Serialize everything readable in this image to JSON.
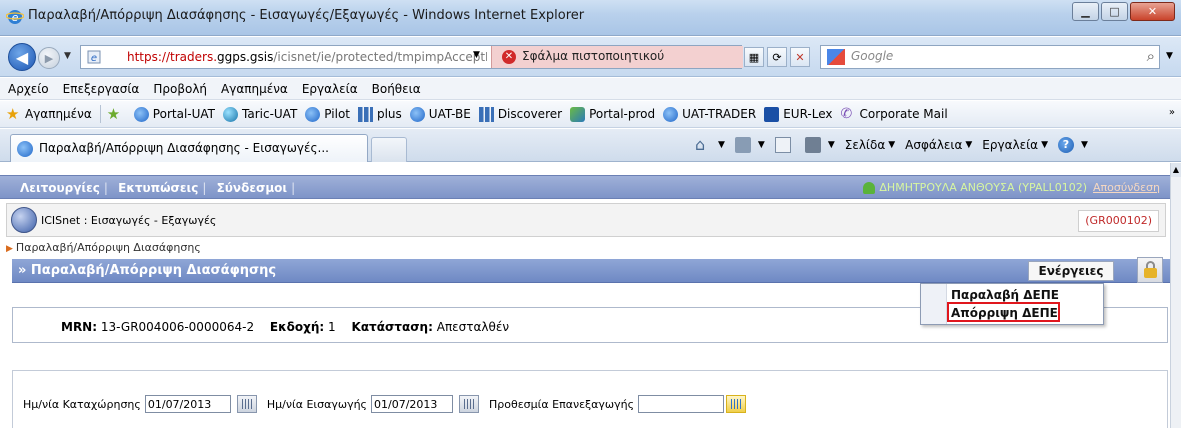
{
  "window": {
    "title": "Παραλαβή/Απόρριψη Διασάφησης - Εισαγωγές/Εξαγωγές - Windows Internet Explorer",
    "min_icon": "minimize-icon",
    "max_icon": "maximize-icon",
    "close_icon": "close-icon"
  },
  "address": {
    "url_prefix": "https://traders.",
    "url_domain": "ggps.gsis",
    "url_rest": "/icisnet/ie/protected/tmpimpAcceptR",
    "cert_error": "Σφάλμα πιστοποιητικού",
    "search_placeholder": "Google"
  },
  "menu": [
    "Αρχείο",
    "Επεξεργασία",
    "Προβολή",
    "Αγαπημένα",
    "Εργαλεία",
    "Βοήθεια"
  ],
  "favorites": {
    "label": "Αγαπημένα",
    "items": [
      "Portal-UAT",
      "Taric-UAT",
      "Pilot",
      "plus",
      "UAT-BE",
      "Discoverer",
      "Portal-prod",
      "UAT-TRADER",
      "EUR-Lex",
      "Corporate Mail"
    ]
  },
  "tab": {
    "title": "Παραλαβή/Απόρριψη Διασάφησης - Εισαγωγές..."
  },
  "commands": {
    "page": "Σελίδα",
    "safety": "Ασφάλεια",
    "tools": "Εργαλεία"
  },
  "app": {
    "nav": [
      "Λειτουργίες",
      "Εκτυπώσεις",
      "Σύνδεσμοι"
    ],
    "user": "ΔΗΜΗΤΡΟΥΛΑ ΑΝΘΟΥΣΑ (YPALL0102)",
    "logout": "Αποσύνδεση",
    "system": "ICISnet : Εισαγωγές - Εξαγωγές",
    "office_code": "(GR000102)",
    "breadcrumb": "Παραλαβή/Απόρριψη Διασάφησης",
    "section_title": "» Παραλαβή/Απόρριψη Διασάφησης",
    "actions_label": "Ενέργειες",
    "actions_menu": [
      "Παραλαβή ΔΕΠΕ",
      "Απόρριψη ΔΕΠΕ"
    ],
    "highlighted_item": "Απόρριψη ΔΕΠΕ"
  },
  "declaration": {
    "mrn_label": "MRN:",
    "mrn_value": "13-GR004006-0000064-2",
    "version_label": "Εκδοχή:",
    "version_value": "1",
    "status_label": "Κατάσταση:",
    "status_value": "Απεσταλθέν"
  },
  "dates": {
    "reg_label": "Ημ/νία Καταχώρησης",
    "reg_value": "01/07/2013",
    "import_label": "Ημ/νία Εισαγωγής",
    "import_value": "01/07/2013",
    "reexport_label": "Προθεσμία Επανεξαγωγής",
    "reexport_value": ""
  }
}
